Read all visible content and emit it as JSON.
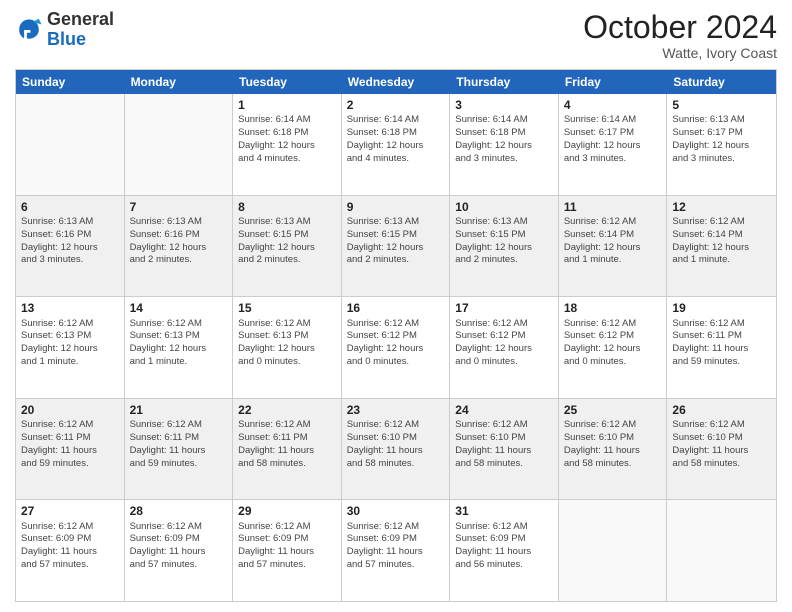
{
  "header": {
    "logo": {
      "general": "General",
      "blue": "Blue"
    },
    "title": "October 2024",
    "location": "Watte, Ivory Coast"
  },
  "days": [
    "Sunday",
    "Monday",
    "Tuesday",
    "Wednesday",
    "Thursday",
    "Friday",
    "Saturday"
  ],
  "rows": [
    [
      {
        "day": "",
        "empty": true
      },
      {
        "day": "",
        "empty": true
      },
      {
        "day": "1",
        "line1": "Sunrise: 6:14 AM",
        "line2": "Sunset: 6:18 PM",
        "line3": "Daylight: 12 hours",
        "line4": "and 4 minutes."
      },
      {
        "day": "2",
        "line1": "Sunrise: 6:14 AM",
        "line2": "Sunset: 6:18 PM",
        "line3": "Daylight: 12 hours",
        "line4": "and 4 minutes."
      },
      {
        "day": "3",
        "line1": "Sunrise: 6:14 AM",
        "line2": "Sunset: 6:18 PM",
        "line3": "Daylight: 12 hours",
        "line4": "and 3 minutes."
      },
      {
        "day": "4",
        "line1": "Sunrise: 6:14 AM",
        "line2": "Sunset: 6:17 PM",
        "line3": "Daylight: 12 hours",
        "line4": "and 3 minutes."
      },
      {
        "day": "5",
        "line1": "Sunrise: 6:13 AM",
        "line2": "Sunset: 6:17 PM",
        "line3": "Daylight: 12 hours",
        "line4": "and 3 minutes."
      }
    ],
    [
      {
        "day": "6",
        "shaded": true,
        "line1": "Sunrise: 6:13 AM",
        "line2": "Sunset: 6:16 PM",
        "line3": "Daylight: 12 hours",
        "line4": "and 3 minutes."
      },
      {
        "day": "7",
        "shaded": true,
        "line1": "Sunrise: 6:13 AM",
        "line2": "Sunset: 6:16 PM",
        "line3": "Daylight: 12 hours",
        "line4": "and 2 minutes."
      },
      {
        "day": "8",
        "shaded": true,
        "line1": "Sunrise: 6:13 AM",
        "line2": "Sunset: 6:15 PM",
        "line3": "Daylight: 12 hours",
        "line4": "and 2 minutes."
      },
      {
        "day": "9",
        "shaded": true,
        "line1": "Sunrise: 6:13 AM",
        "line2": "Sunset: 6:15 PM",
        "line3": "Daylight: 12 hours",
        "line4": "and 2 minutes."
      },
      {
        "day": "10",
        "shaded": true,
        "line1": "Sunrise: 6:13 AM",
        "line2": "Sunset: 6:15 PM",
        "line3": "Daylight: 12 hours",
        "line4": "and 2 minutes."
      },
      {
        "day": "11",
        "shaded": true,
        "line1": "Sunrise: 6:12 AM",
        "line2": "Sunset: 6:14 PM",
        "line3": "Daylight: 12 hours",
        "line4": "and 1 minute."
      },
      {
        "day": "12",
        "shaded": true,
        "line1": "Sunrise: 6:12 AM",
        "line2": "Sunset: 6:14 PM",
        "line3": "Daylight: 12 hours",
        "line4": "and 1 minute."
      }
    ],
    [
      {
        "day": "13",
        "line1": "Sunrise: 6:12 AM",
        "line2": "Sunset: 6:13 PM",
        "line3": "Daylight: 12 hours",
        "line4": "and 1 minute."
      },
      {
        "day": "14",
        "line1": "Sunrise: 6:12 AM",
        "line2": "Sunset: 6:13 PM",
        "line3": "Daylight: 12 hours",
        "line4": "and 1 minute."
      },
      {
        "day": "15",
        "line1": "Sunrise: 6:12 AM",
        "line2": "Sunset: 6:13 PM",
        "line3": "Daylight: 12 hours",
        "line4": "and 0 minutes."
      },
      {
        "day": "16",
        "line1": "Sunrise: 6:12 AM",
        "line2": "Sunset: 6:12 PM",
        "line3": "Daylight: 12 hours",
        "line4": "and 0 minutes."
      },
      {
        "day": "17",
        "line1": "Sunrise: 6:12 AM",
        "line2": "Sunset: 6:12 PM",
        "line3": "Daylight: 12 hours",
        "line4": "and 0 minutes."
      },
      {
        "day": "18",
        "line1": "Sunrise: 6:12 AM",
        "line2": "Sunset: 6:12 PM",
        "line3": "Daylight: 12 hours",
        "line4": "and 0 minutes."
      },
      {
        "day": "19",
        "line1": "Sunrise: 6:12 AM",
        "line2": "Sunset: 6:11 PM",
        "line3": "Daylight: 11 hours",
        "line4": "and 59 minutes."
      }
    ],
    [
      {
        "day": "20",
        "shaded": true,
        "line1": "Sunrise: 6:12 AM",
        "line2": "Sunset: 6:11 PM",
        "line3": "Daylight: 11 hours",
        "line4": "and 59 minutes."
      },
      {
        "day": "21",
        "shaded": true,
        "line1": "Sunrise: 6:12 AM",
        "line2": "Sunset: 6:11 PM",
        "line3": "Daylight: 11 hours",
        "line4": "and 59 minutes."
      },
      {
        "day": "22",
        "shaded": true,
        "line1": "Sunrise: 6:12 AM",
        "line2": "Sunset: 6:11 PM",
        "line3": "Daylight: 11 hours",
        "line4": "and 58 minutes."
      },
      {
        "day": "23",
        "shaded": true,
        "line1": "Sunrise: 6:12 AM",
        "line2": "Sunset: 6:10 PM",
        "line3": "Daylight: 11 hours",
        "line4": "and 58 minutes."
      },
      {
        "day": "24",
        "shaded": true,
        "line1": "Sunrise: 6:12 AM",
        "line2": "Sunset: 6:10 PM",
        "line3": "Daylight: 11 hours",
        "line4": "and 58 minutes."
      },
      {
        "day": "25",
        "shaded": true,
        "line1": "Sunrise: 6:12 AM",
        "line2": "Sunset: 6:10 PM",
        "line3": "Daylight: 11 hours",
        "line4": "and 58 minutes."
      },
      {
        "day": "26",
        "shaded": true,
        "line1": "Sunrise: 6:12 AM",
        "line2": "Sunset: 6:10 PM",
        "line3": "Daylight: 11 hours",
        "line4": "and 58 minutes."
      }
    ],
    [
      {
        "day": "27",
        "line1": "Sunrise: 6:12 AM",
        "line2": "Sunset: 6:09 PM",
        "line3": "Daylight: 11 hours",
        "line4": "and 57 minutes."
      },
      {
        "day": "28",
        "line1": "Sunrise: 6:12 AM",
        "line2": "Sunset: 6:09 PM",
        "line3": "Daylight: 11 hours",
        "line4": "and 57 minutes."
      },
      {
        "day": "29",
        "line1": "Sunrise: 6:12 AM",
        "line2": "Sunset: 6:09 PM",
        "line3": "Daylight: 11 hours",
        "line4": "and 57 minutes."
      },
      {
        "day": "30",
        "line1": "Sunrise: 6:12 AM",
        "line2": "Sunset: 6:09 PM",
        "line3": "Daylight: 11 hours",
        "line4": "and 57 minutes."
      },
      {
        "day": "31",
        "line1": "Sunrise: 6:12 AM",
        "line2": "Sunset: 6:09 PM",
        "line3": "Daylight: 11 hours",
        "line4": "and 56 minutes."
      },
      {
        "day": "",
        "empty": true
      },
      {
        "day": "",
        "empty": true
      }
    ]
  ]
}
